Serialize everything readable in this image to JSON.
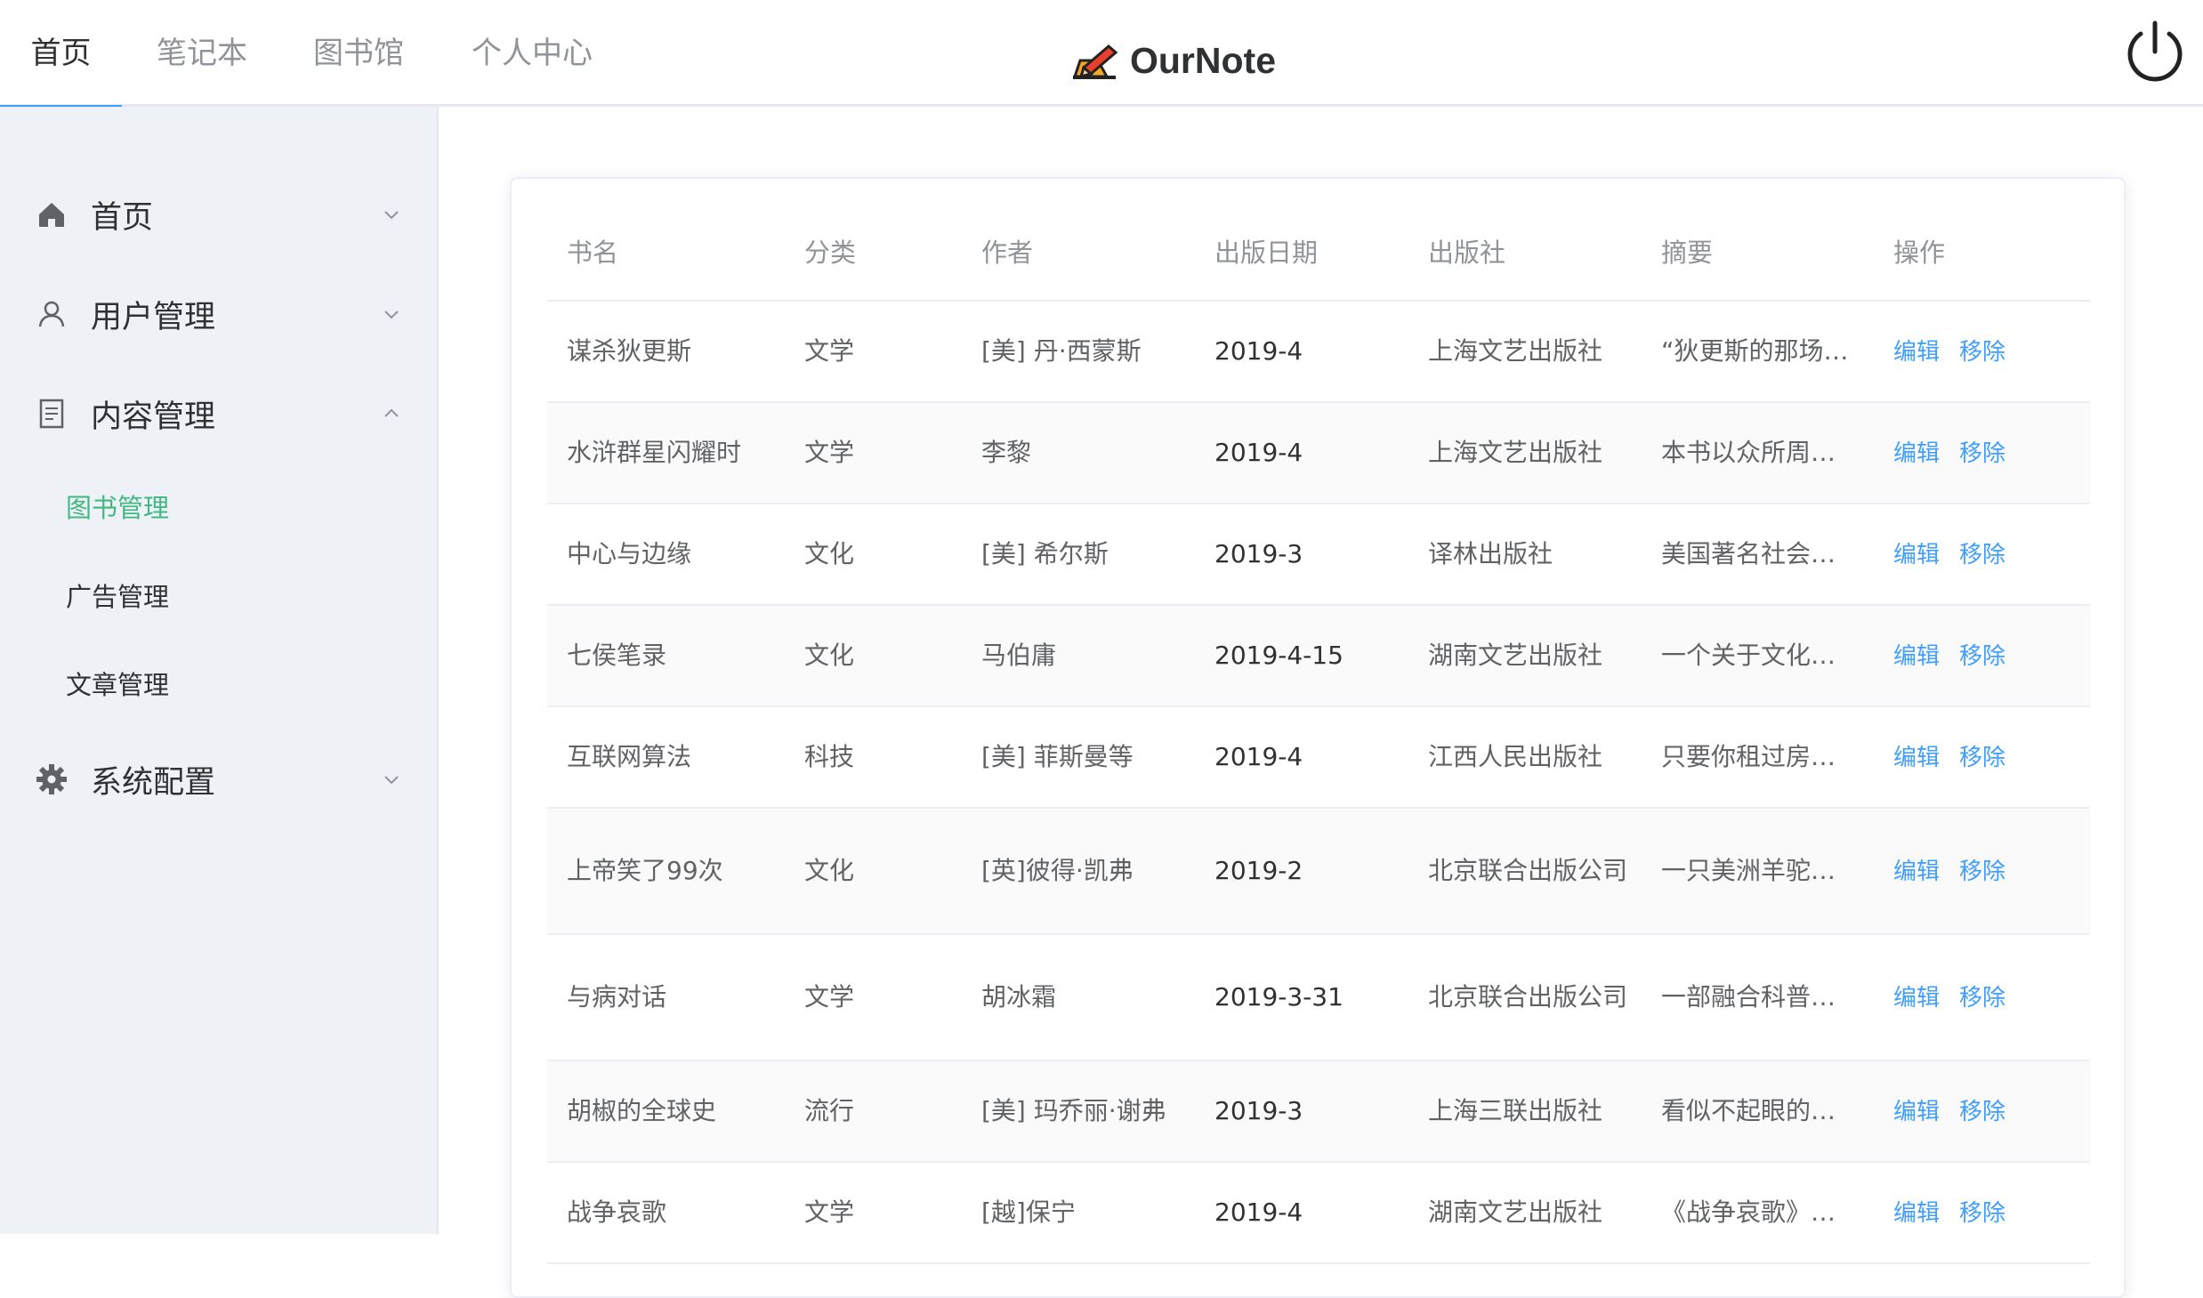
{
  "header": {
    "tabs": [
      {
        "label": "首页",
        "active": true
      },
      {
        "label": "笔记本",
        "active": false
      },
      {
        "label": "图书馆",
        "active": false
      },
      {
        "label": "个人中心",
        "active": false
      }
    ],
    "logo_text": "OurNote",
    "accent": "#409eff"
  },
  "sidebar": {
    "items": [
      {
        "label": "首页",
        "icon": "home-icon",
        "expanded": false
      },
      {
        "label": "用户管理",
        "icon": "user-icon",
        "expanded": false
      },
      {
        "label": "内容管理",
        "icon": "document-icon",
        "expanded": true
      },
      {
        "label": "系统配置",
        "icon": "gear-icon",
        "expanded": false
      }
    ],
    "subitems": [
      {
        "label": "图书管理",
        "active": true
      },
      {
        "label": "广告管理",
        "active": false
      },
      {
        "label": "文章管理",
        "active": false
      }
    ],
    "active_color": "#41b883"
  },
  "table": {
    "columns": [
      "书名",
      "分类",
      "作者",
      "出版日期",
      "出版社",
      "摘要",
      "操作"
    ],
    "edit_label": "编辑",
    "remove_label": "移除",
    "rows": [
      {
        "title": "谋杀狄更斯",
        "category": "文学",
        "author": "[美] 丹·西蒙斯",
        "date": "2019-4",
        "publisher": "上海文艺出版社",
        "summary": "“狄更斯的那场…"
      },
      {
        "title": "水浒群星闪耀时",
        "category": "文学",
        "author": "李黎",
        "date": "2019-4",
        "publisher": "上海文艺出版社",
        "summary": "本书以众所周…"
      },
      {
        "title": "中心与边缘",
        "category": "文化",
        "author": "[美] 希尔斯",
        "date": "2019-3",
        "publisher": "译林出版社",
        "summary": "美国著名社会…"
      },
      {
        "title": "七侯笔录",
        "category": "文化",
        "author": "马伯庸",
        "date": "2019-4-15",
        "publisher": "湖南文艺出版社",
        "summary": "一个关于文化…"
      },
      {
        "title": "互联网算法",
        "category": "科技",
        "author": "[美] 菲斯曼等",
        "date": "2019-4",
        "publisher": "江西人民出版社",
        "summary": "只要你租过房…"
      },
      {
        "title": "上帝笑了99次",
        "category": "文化",
        "author": "[英]彼得·凯弗",
        "date": "2019-2",
        "publisher": "北京联合出版公司",
        "summary": "一只美洲羊驼…"
      },
      {
        "title": "与病对话",
        "category": "文学",
        "author": "胡冰霜",
        "date": "2019-3-31",
        "publisher": "北京联合出版公司",
        "summary": "一部融合科普…"
      },
      {
        "title": "胡椒的全球史",
        "category": "流行",
        "author": "[美] 玛乔丽·谢弗",
        "date": "2019-3",
        "publisher": "上海三联出版社",
        "summary": "看似不起眼的…"
      },
      {
        "title": "战争哀歌",
        "category": "文学",
        "author": "[越]保宁",
        "date": "2019-4",
        "publisher": "湖南文艺出版社",
        "summary": "《战争哀歌》…"
      }
    ]
  }
}
